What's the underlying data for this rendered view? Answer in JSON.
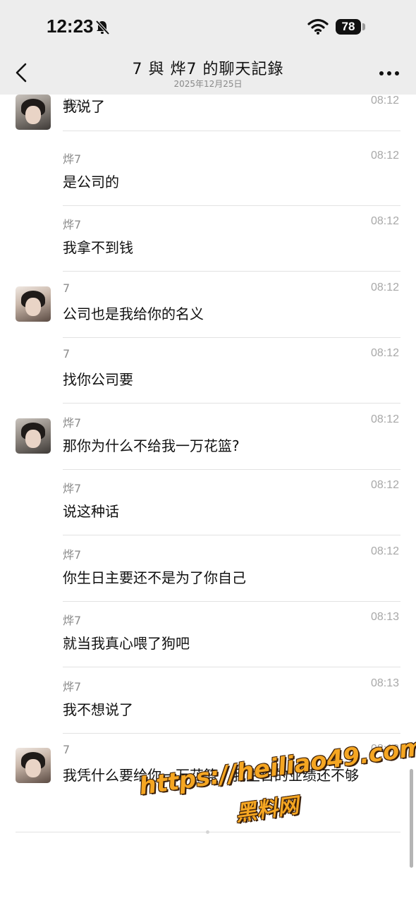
{
  "status_bar": {
    "time": "12:23",
    "battery": "78",
    "icons": [
      "bell-slash-icon",
      "wifi-icon",
      "battery-icon"
    ]
  },
  "nav": {
    "title": "7 與 烨7 的聊天記錄",
    "subtitle": "2025年12月25日",
    "back_icon": "chevron-left-icon",
    "more_icon": "more-dots-icon"
  },
  "messages": [
    {
      "sender": "烨7",
      "time": "08:12",
      "text": "我说了",
      "avatar": "male"
    },
    {
      "sender": "烨7",
      "time": "08:12",
      "text": "是公司的",
      "avatar": ""
    },
    {
      "sender": "烨7",
      "time": "08:12",
      "text": "我拿不到钱",
      "avatar": ""
    },
    {
      "sender": "7",
      "time": "08:12",
      "text": "公司也是我给你的名义",
      "avatar": "female"
    },
    {
      "sender": "7",
      "time": "08:12",
      "text": "找你公司要",
      "avatar": ""
    },
    {
      "sender": "烨7",
      "time": "08:12",
      "text": "那你为什么不给我一万花篮?",
      "avatar": "male"
    },
    {
      "sender": "烨7",
      "time": "08:12",
      "text": "说这种话",
      "avatar": ""
    },
    {
      "sender": "烨7",
      "time": "08:12",
      "text": "你生日主要还不是为了你自己",
      "avatar": ""
    },
    {
      "sender": "烨7",
      "time": "08:13",
      "text": "就当我真心喂了狗吧",
      "avatar": ""
    },
    {
      "sender": "烨7",
      "time": "08:13",
      "text": "我不想说了",
      "avatar": ""
    },
    {
      "sender": "7",
      "time": "08:13",
      "text": "我凭什么要给你一万花篮，我生日的业绩还不够",
      "avatar": "female"
    }
  ],
  "watermark": {
    "line1": "https://heiliao49.com",
    "line2": "黑料网"
  },
  "colors": {
    "header_bg": "#ededed",
    "watermark": "#f5a622"
  }
}
